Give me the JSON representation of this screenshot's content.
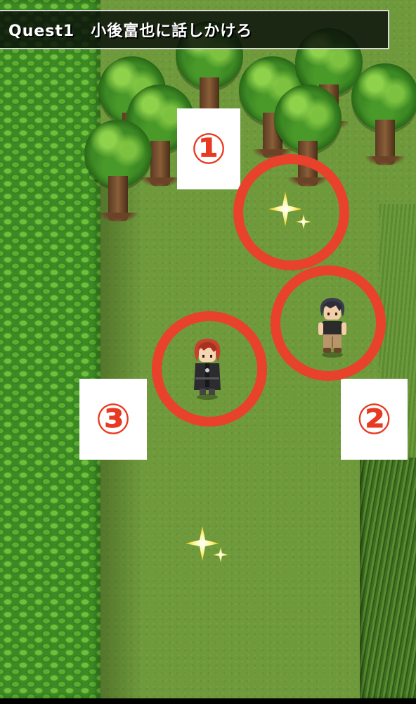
{
  "quest": {
    "title": "Quest1　小後富也に話しかけろ"
  },
  "markers": {
    "one": "①",
    "two": "②",
    "three": "③"
  },
  "colors": {
    "ring": "#e8412c",
    "label_text": "#e83a22",
    "path_grass": "#6f9a3c",
    "bush": "#3d8a24"
  },
  "scene": {
    "sparkle_icon": "sparkle-icon",
    "characters": [
      "dark-haired-npc",
      "red-haired-player"
    ]
  }
}
